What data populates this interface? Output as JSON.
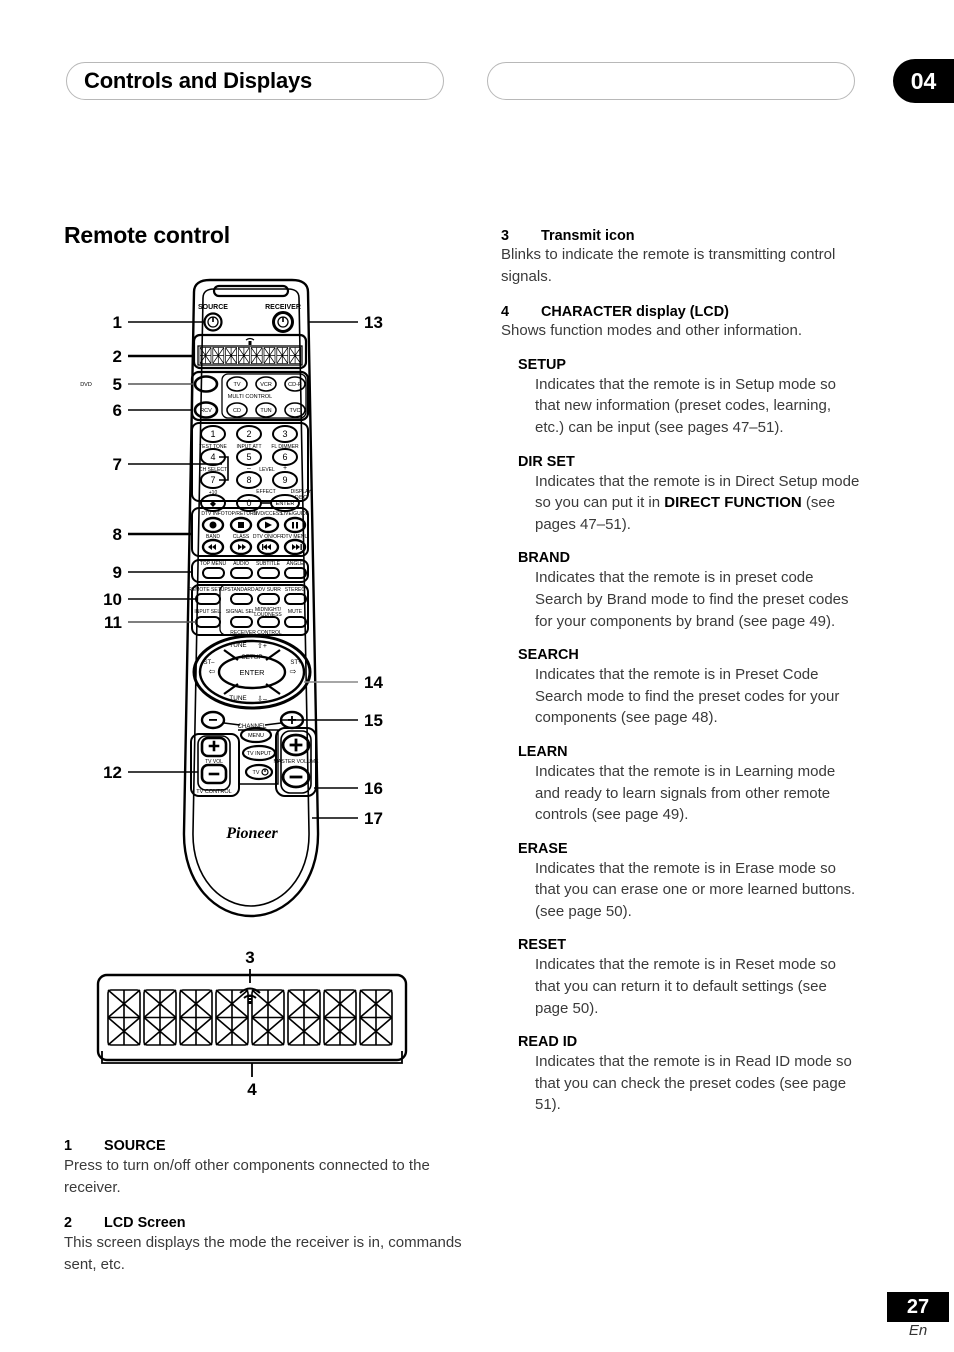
{
  "header": {
    "chapter_title": "Controls and Displays",
    "chapter_number": "04"
  },
  "footer": {
    "page_number": "27",
    "language": "En"
  },
  "left_column": {
    "section_title": "Remote control",
    "items": [
      {
        "number": "1",
        "title": "SOURCE",
        "body": "Press to turn on/off other components connected to the receiver."
      },
      {
        "number": "2",
        "title": "LCD Screen",
        "body": "This screen displays the mode the receiver is in, commands sent, etc."
      }
    ]
  },
  "right_column": {
    "items": [
      {
        "number": "3",
        "title": "Transmit icon",
        "body": "Blinks to indicate the remote is transmitting control signals."
      },
      {
        "number": "4",
        "title": "CHARACTER display (LCD)",
        "body": "Shows function modes and other information."
      }
    ],
    "modes": [
      {
        "name": "SETUP",
        "body": "Indicates that the remote is in Setup mode so that new information (preset codes, learning, etc.) can be input (see pages 47–51)."
      },
      {
        "name": "DIR SET",
        "body_pre": "Indicates that the remote is in Direct Setup mode so you can put it in ",
        "body_bold": "DIRECT FUNCTION",
        "body_post": " (see pages 47–51)."
      },
      {
        "name": "BRAND",
        "body": "Indicates that the remote is in preset code Search by Brand mode to find the preset codes for your components by brand (see page 49)."
      },
      {
        "name": "SEARCH",
        "body": "Indicates that the remote is in Preset Code Search mode to find the preset codes for your components (see page 48)."
      },
      {
        "name": "LEARN",
        "body": "Indicates that the remote is in Learning mode and ready to learn signals from other remote controls (see page 49)."
      },
      {
        "name": "ERASE",
        "body": "Indicates that the remote is in Erase mode so that you can erase one or more learned buttons. (see page 50)."
      },
      {
        "name": "RESET",
        "body": "Indicates that the remote is in Reset mode so that you can return it to default settings (see page 50)."
      },
      {
        "name": "READ ID",
        "body": "Indicates that the remote is in Read ID mode so that you can check the preset codes (see page 51)."
      }
    ]
  },
  "remote_figure": {
    "brand": "Pioneer",
    "callouts": [
      "1",
      "2",
      "5",
      "6",
      "7",
      "8",
      "9",
      "10",
      "11",
      "12",
      "13",
      "14",
      "15",
      "16",
      "17"
    ],
    "labels": {
      "source": "SOURCE",
      "receiver": "RECEIVER",
      "multi_control": "MULTI CONTROL",
      "receiver_control": "RECEIVER CONTROL",
      "tv_control": "TV CONTROL",
      "master_volume": "MASTER VOLUME",
      "tv_vol": "TV VOL",
      "tv_input": "TV INPUT",
      "tv_power": "TV",
      "menu": "MENU",
      "channel": "CHANNEL",
      "setup": "SETUP",
      "enter": "ENTER",
      "tune_up": "TUNE",
      "tune_down": "TUNE",
      "st_minus": "ST",
      "st_plus": "ST"
    },
    "multi_control_buttons": [
      "DVD",
      "TV",
      "VCR",
      "CD-R",
      "RCV",
      "CD",
      "TUN",
      "TVC"
    ],
    "numeric_keys": [
      "1",
      "2",
      "3",
      "4",
      "5",
      "6",
      "7",
      "8",
      "9",
      "0"
    ],
    "numeric_sublabels": [
      "TEST TONE",
      "INPUT ATT",
      "FL DIMMER",
      "CH SELECT",
      "LEVEL",
      "+10",
      "EFFECT",
      "DISPLAY",
      "DISC",
      "ENTER"
    ],
    "transport_top_labels": [
      "DTV INFO",
      "TOP/RETURN",
      "DVD/CCESS",
      "LIVE/GUIDE"
    ],
    "transport_mid_labels": [
      "BAND",
      "CLASS",
      "DTV ON/OFF",
      "DTV MENU"
    ],
    "dvd_row_labels": [
      "TOP MENU",
      "AUDIO",
      "SUBTITLE",
      "ANGLE"
    ],
    "surround_row_labels": [
      "REMOTE SETUP",
      "STANDARD",
      "ADV SURR",
      "STEREO"
    ],
    "input_row_labels": [
      "INPUT SEL.",
      "SIGNAL SEL.",
      "MIDNIGHT/ LOUDNESS",
      "MUTE"
    ]
  },
  "lcd_figure": {
    "callout_transmit": "3",
    "callout_character": "4",
    "segment_count": 8
  }
}
